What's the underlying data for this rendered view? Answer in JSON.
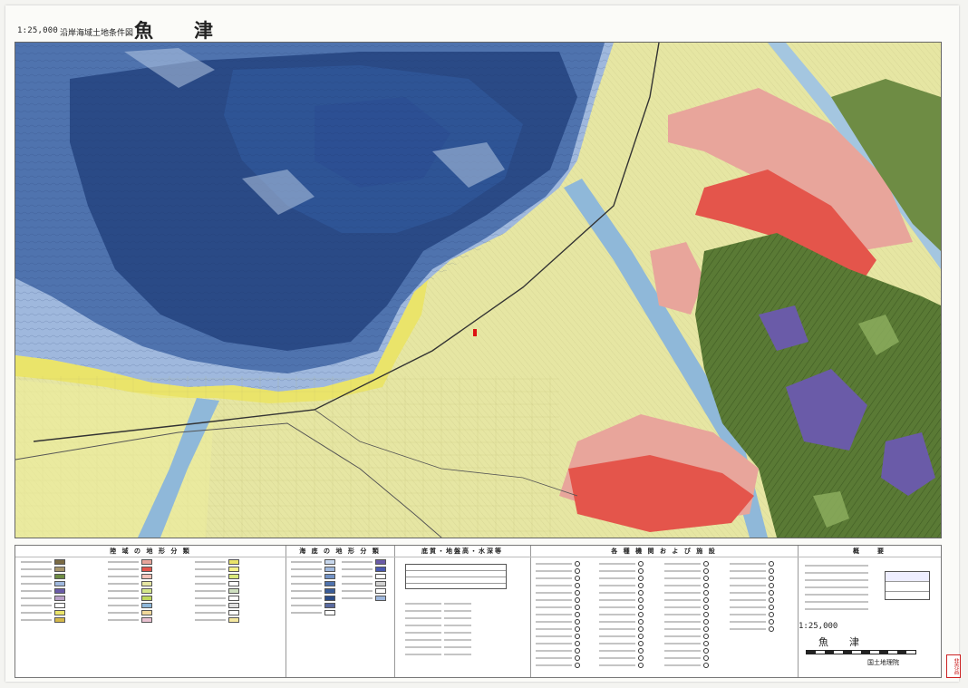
{
  "header": {
    "scale": "1:25,000",
    "series": "沿岸海域土地条件図",
    "name": "魚　津"
  },
  "legend": {
    "col_landform_title": "陸 域 の 地 形 分 類",
    "col_seafloor_title": "海 底 の 地 形 分 類",
    "col_geology_title": "底質・地盤高・水深等",
    "col_facilities_title": "各 種 機 関 お よ び 施 設",
    "col_outline_title": "概　　要",
    "scale": "1:25,000",
    "name": "魚　津",
    "publisher": "国土地理院"
  },
  "stamp": "非売品",
  "colors": {
    "sea_deep": "#2a4a86",
    "sea_mid": "#4f73ae",
    "sea_shallow": "#9fb8dd",
    "coast_yellow": "#eae46a",
    "plain": "#e6e6a3",
    "terrace_pink": "#e8a59b",
    "terrace_red": "#e4554b",
    "mountain_green": "#5a7a35",
    "valley_purple": "#6a5ba8",
    "river_blue": "#8fb8d9"
  }
}
